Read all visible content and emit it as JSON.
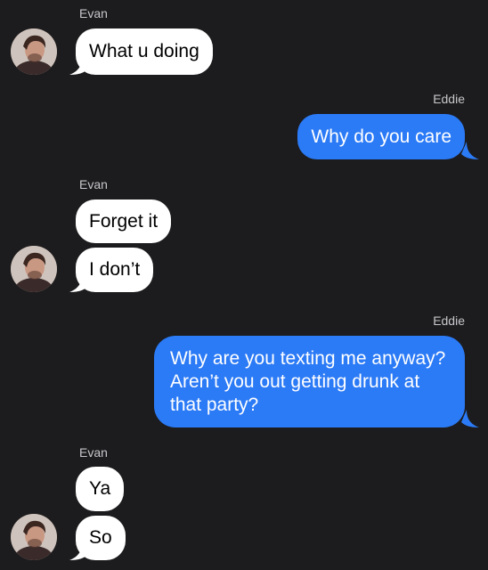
{
  "conversation": {
    "contacts": {
      "them": "Evan",
      "me": "Eddie"
    },
    "messages": [
      {
        "from": "Evan",
        "text": "What u doing"
      },
      {
        "from": "Eddie",
        "text": "Why do you care"
      },
      {
        "from": "Evan",
        "text": "Forget it"
      },
      {
        "from": "Evan",
        "text": "I don’t"
      },
      {
        "from": "Eddie",
        "text": "Why are you texting me anyway? Aren’t you out getting drunk at that party?"
      },
      {
        "from": "Evan",
        "text": "Ya"
      },
      {
        "from": "Evan",
        "text": "So"
      }
    ],
    "labels": [
      {
        "text": "Evan"
      },
      {
        "text": "Eddie"
      },
      {
        "text": "Evan"
      },
      {
        "text": "Eddie"
      },
      {
        "text": "Evan"
      }
    ]
  },
  "colors": {
    "background": "#1c1c1e",
    "incoming_bubble": "#ffffff",
    "outgoing_bubble": "#2b7af6",
    "sender_label": "#c7c7cc"
  },
  "icons": {
    "avatar": "contact-photo-evan"
  }
}
